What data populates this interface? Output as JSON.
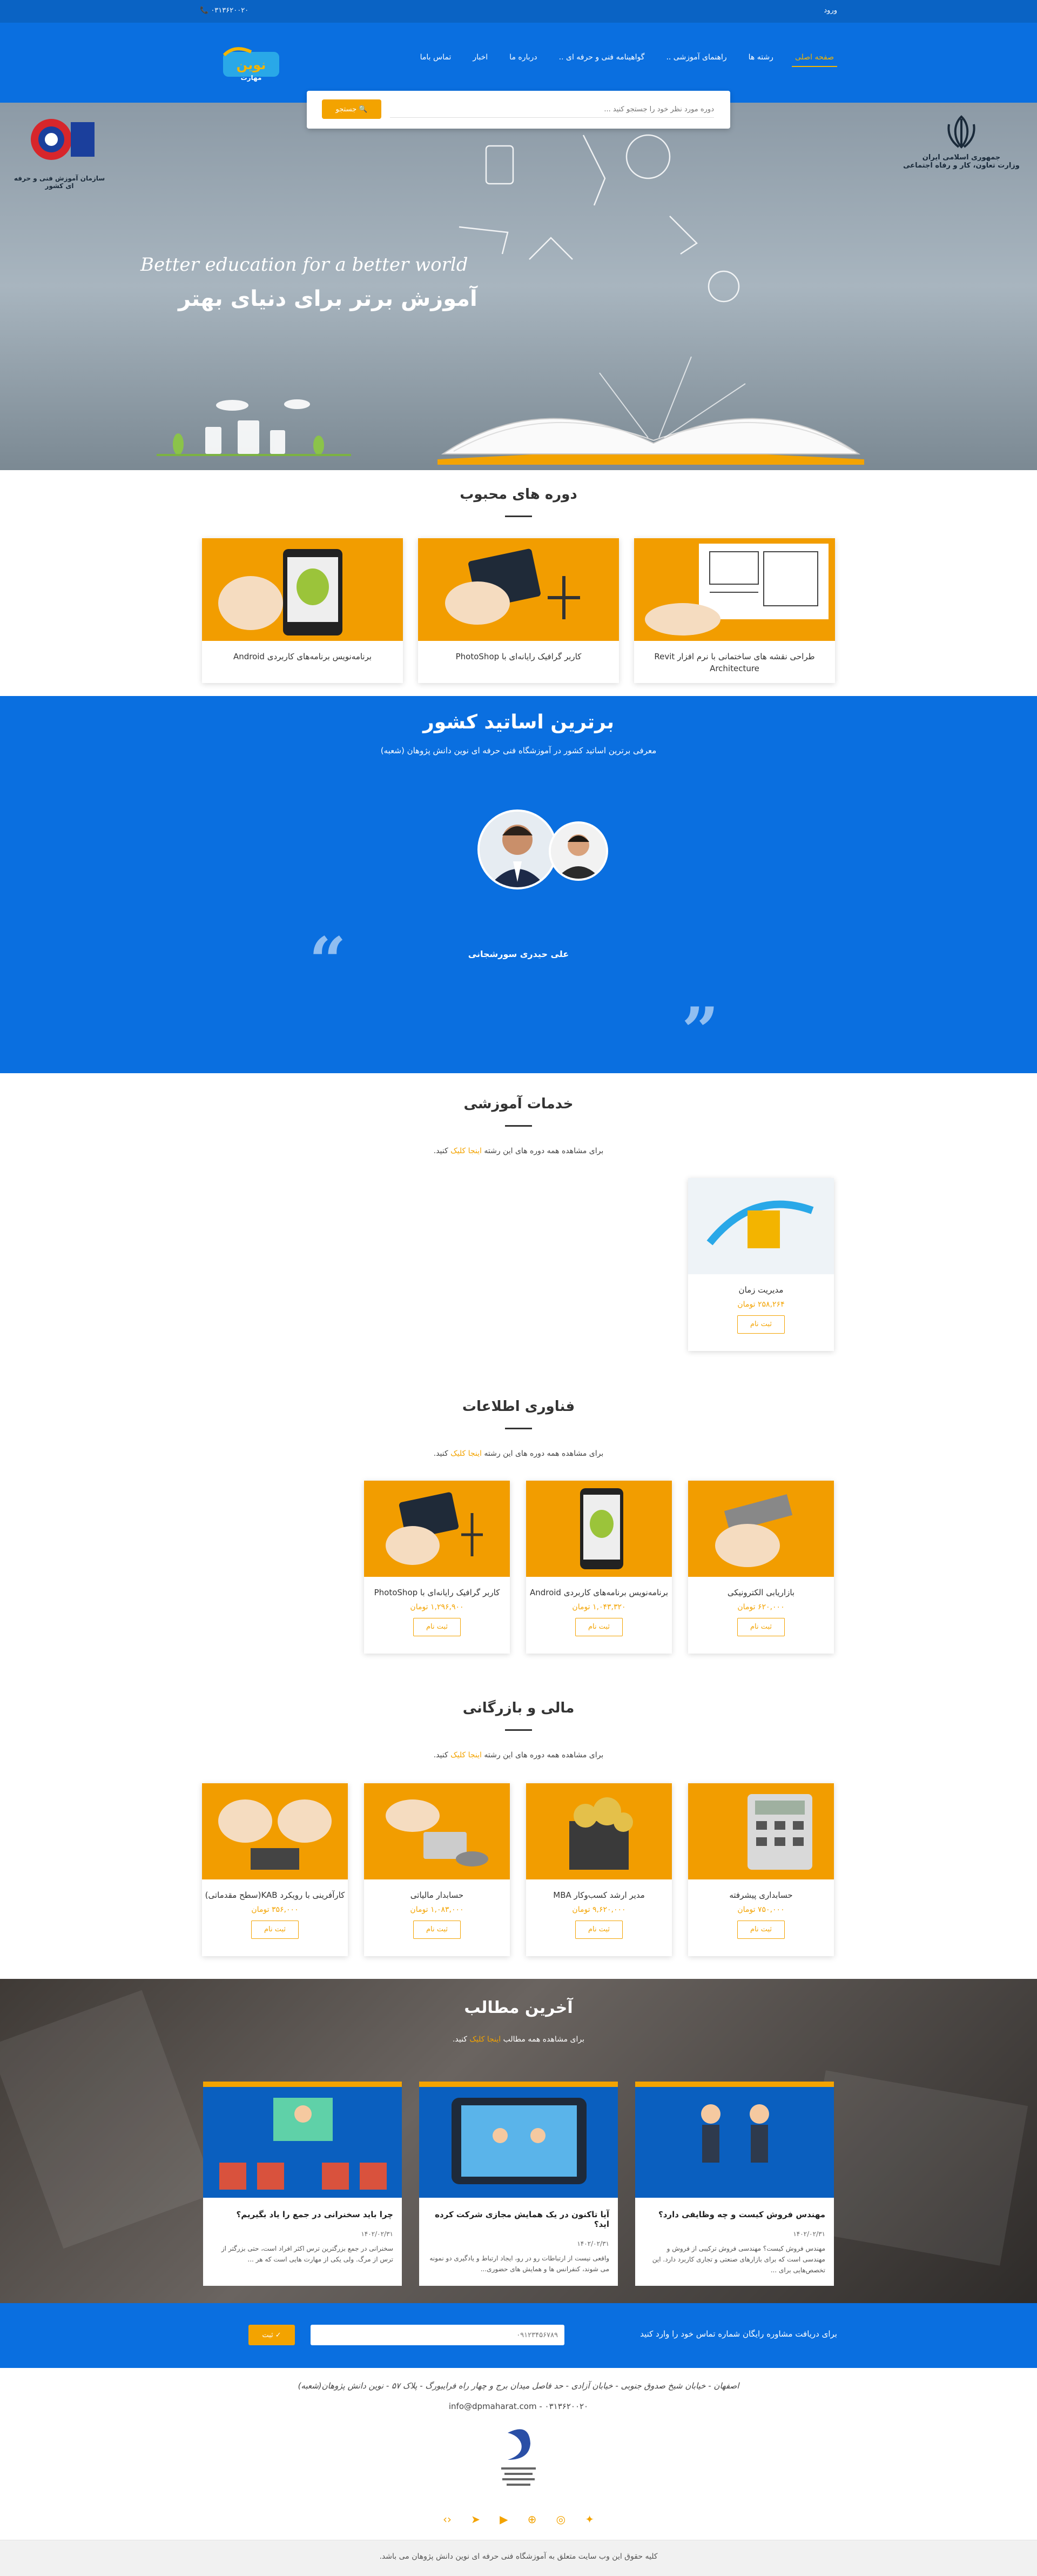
{
  "topbar": {
    "phone": "۰۳۱۳۶۲۰۰۲۰",
    "login": "ورود"
  },
  "nav": {
    "items": [
      "صفحه اصلی",
      "رشته ها",
      "راهنمای آموزشی ..",
      "گواهینامه فنی و حرفه ای ..",
      "درباره ما",
      "اخبار",
      "تماس باما"
    ]
  },
  "search": {
    "placeholder": "دوره مورد نظر خود را جستجو کنید ...",
    "button": "جستجو"
  },
  "hero": {
    "english": "Better education for a better world",
    "persian": "آموزش برتر برای دنیای بهتر",
    "org_left": "سازمان آموزش فنی و حرفه ای کشور",
    "org_right_1": "جمهوری اسلامی ایران",
    "org_right_2": "وزارت تعاون، کار و رفاه اجتماعی"
  },
  "popular": {
    "title": "دوره های محبوب",
    "courses": [
      "طراحی نقشه های ساختمانی با نرم افزار Revit Architecture",
      "کاربر گرافیک رایانه‌ای با PhotoShop",
      "برنامه‌نویس برنامه‌های کاربردی Android"
    ]
  },
  "teachers": {
    "title": "برترین اساتید کشور",
    "subtitle": "معرفی برترین اساتید کشور در آموزشگاه فنی حرفه ای نوین دانش پژوهان (شعبه)",
    "name": "علی حیدری سورشجانی"
  },
  "sections": {
    "link_text": "اینجا کلیک",
    "sub_before": "برای مشاهده همه دوره های این رشته",
    "sub_after": "کنید.",
    "buy_label": "ثبت نام",
    "edu": {
      "title": "خدمات آموزشی",
      "courses": [
        {
          "title": "مدیریت زمان",
          "price": "۲۵۸,۲۶۴ تومان"
        }
      ]
    },
    "it": {
      "title": "فناوری اطلاعات",
      "courses": [
        {
          "title": "بازاریابی الکترونیکی",
          "price": "۶۲۰,۰۰۰ تومان"
        },
        {
          "title": "برنامه‌نویس برنامه‌های کاربردی Android",
          "price": "۱,۰۴۳,۳۲۰ تومان"
        },
        {
          "title": "کاربر گرافیک رایانه‌ای با PhotoShop",
          "price": "۱,۲۹۶,۹۰۰ تومان"
        }
      ]
    },
    "finance": {
      "title": "مالی و بازرگانی",
      "courses": [
        {
          "title": "حسابداری پیشرفته",
          "price": "۷۵۰,۰۰۰ تومان"
        },
        {
          "title": "مدیر ارشد کسب‌وکار MBA",
          "price": "۹,۶۲۰,۰۰۰ تومان"
        },
        {
          "title": "حسابدار مالیاتی",
          "price": "۱,۰۸۳,۰۰۰ تومان"
        },
        {
          "title": "کارآفرینی با رویکرد KAB(سطح مقدماتی)",
          "price": "۳۵۶,۰۰۰ تومان"
        }
      ]
    }
  },
  "latest": {
    "title": "آخرین مطالب",
    "sub_before": "برای مشاهده همه مطالب",
    "sub_after": "کنید.",
    "link_text": "اینجا کلیک",
    "posts": [
      {
        "title": "مهندس فروش کیست و چه وظایفی دارد؟",
        "date": "۱۴۰۲/۰۲/۳۱",
        "excerpt": "مهندس فروش کیست؟ مهندسی فروش ترکیبی از فروش و مهندسی است که برای بازارهای صنعتی و تجاری کاربرد دارد. این تخصص‌هایی برای ..."
      },
      {
        "title": "آیا تاکنون در یک همایش مجازی شرکت کرده اید؟",
        "date": "۱۴۰۲/۰۲/۳۱",
        "excerpt": "واقعی نیست از ارتباطات رو در رو، ایجاد ارتباط و یادگیری دو نمونه می شوند، کنفرانس ها و همایش های حضوری..."
      },
      {
        "title": "چرا باید سخنرانی در جمع را یاد بگیریم؟",
        "date": "۱۴۰۲/۰۲/۳۱",
        "excerpt": "سخنرانی در جمع بزرگترین ترس اکثر افراد است، حتی بزرگتر از ترس از مرگ. ولی یکی از مهارت هایی است که هر ..."
      }
    ]
  },
  "consult": {
    "label": "برای دریافت مشاوره رایگان شماره تماس خود را وارد کنید",
    "placeholder": "۰۹۱۲۳۴۵۶۷۸۹",
    "button": "ثبت"
  },
  "footer": {
    "address": "اصفهان - خیابان شیخ صدوق جنوبی - خیابان آزادی - حد فاصل میدان برج و چهار راه فرایبورگ - پلاک ۵۷ - نوین دانش پژوهان(شعبه)",
    "contact": "info@dpmaharat.com  -  ۰۳۱۳۶۲۰۰۲۰",
    "copyright": "کلیه حقوق این وب سایت متعلق به آموزشگاه فنی حرفه ای نوین دانش پژوهان می باشد."
  },
  "colors": {
    "primary": "#0a6fe0",
    "accent": "#f3a300",
    "topbar": "#0a63c4"
  }
}
